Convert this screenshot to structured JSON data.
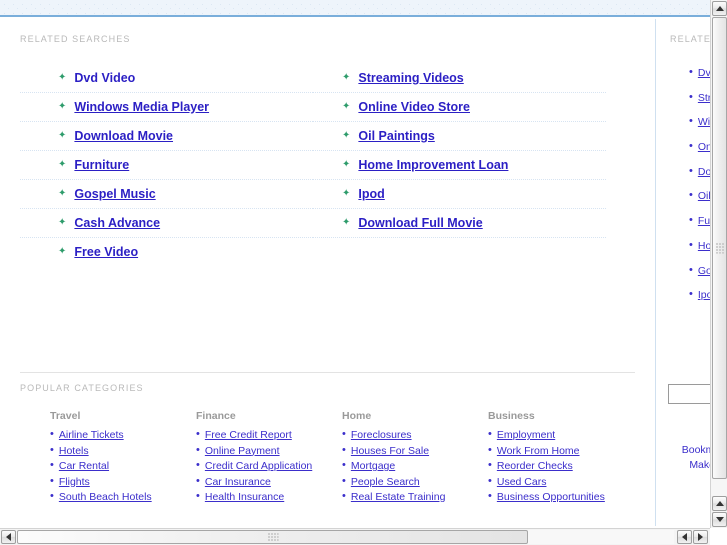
{
  "banner": {
    "label": "top-banner"
  },
  "related_searches": {
    "title": "RELATED SEARCHES",
    "left_column": [
      {
        "label": "Dvd Video",
        "underlined": false
      },
      {
        "label": "Windows Media Player",
        "underlined": true
      },
      {
        "label": "Download Movie",
        "underlined": true
      },
      {
        "label": "Furniture",
        "underlined": true
      },
      {
        "label": "Gospel Music",
        "underlined": true
      },
      {
        "label": "Cash Advance",
        "underlined": true
      },
      {
        "label": "Free Video",
        "underlined": true
      }
    ],
    "right_column": [
      {
        "label": "Streaming Videos",
        "underlined": true
      },
      {
        "label": "Online Video Store",
        "underlined": true
      },
      {
        "label": "Oil Paintings",
        "underlined": true
      },
      {
        "label": "Home Improvement Loan",
        "underlined": true
      },
      {
        "label": "Ipod",
        "underlined": true
      },
      {
        "label": "Download Full Movie",
        "underlined": true
      }
    ],
    "bullet_icon": "star-bullet-icon",
    "bullet_glyph": "✦",
    "bullet_color": "#2e9c6b",
    "link_color": "#2b1fc4"
  },
  "popular_categories": {
    "title": "POPULAR CATEGORIES",
    "columns": [
      {
        "heading": "Travel",
        "items": [
          "Airline Tickets",
          "Hotels",
          "Car Rental",
          "Flights",
          "South Beach Hotels"
        ]
      },
      {
        "heading": "Finance",
        "items": [
          "Free Credit Report",
          "Online Payment",
          "Credit Card Application",
          "Car Insurance",
          "Health Insurance"
        ]
      },
      {
        "heading": "Home",
        "items": [
          "Foreclosures",
          "Houses For Sale",
          "Mortgage",
          "People Search",
          "Real Estate Training"
        ]
      },
      {
        "heading": "Business",
        "items": [
          "Employment",
          "Work From Home",
          "Reorder Checks",
          "Used Cars",
          "Business Opportunities"
        ]
      }
    ],
    "bullet_glyph": "•",
    "link_color": "#3b2ecb",
    "heading_color": "#9a9a9a"
  },
  "side_rail": {
    "title": "RELATED",
    "items": [
      "Dv",
      "Str",
      "Wi",
      "On",
      "Do",
      "Oil",
      "Fu",
      "Ho",
      "Go",
      "Ipo"
    ],
    "search_value": "",
    "search_placeholder": "",
    "actions": [
      "Bookmark",
      "Make thi"
    ],
    "bullet_glyph": "•"
  },
  "scrollbars": {
    "vertical": {
      "up_icon": "triangle-up-icon",
      "down_icon": "triangle-down-icon",
      "thumb": "vertical-scroll-thumb"
    },
    "horizontal": {
      "left_icon": "triangle-left-icon",
      "right_icon": "triangle-right-icon",
      "thumb": "horizontal-scroll-thumb"
    }
  }
}
